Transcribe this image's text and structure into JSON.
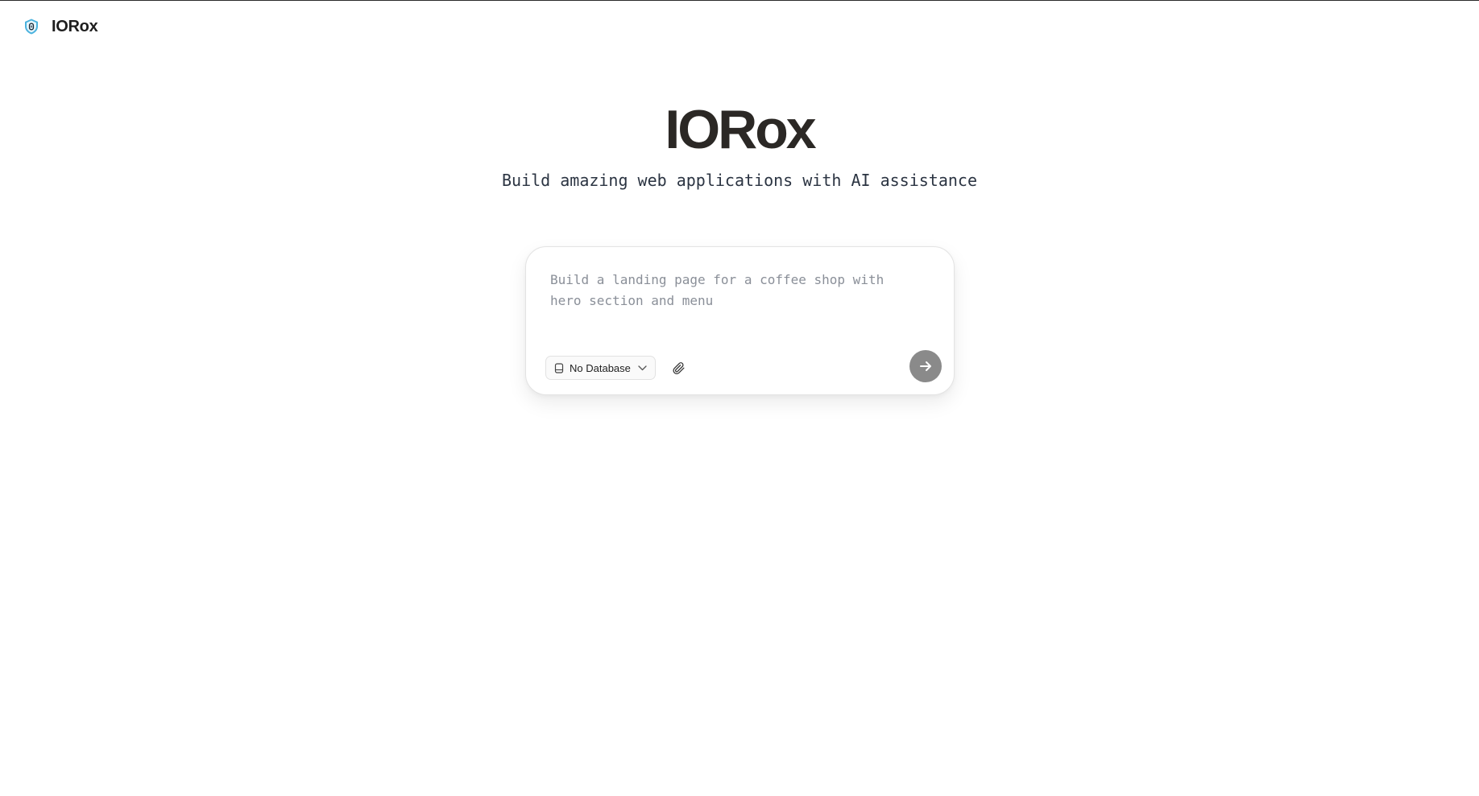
{
  "header": {
    "brand_name": "IORox",
    "logo_icon": "shield-logo-icon"
  },
  "hero": {
    "title": "IORox",
    "subtitle": "Build amazing web applications with AI assistance"
  },
  "prompt": {
    "placeholder": "Build a landing page for a coffee shop with hero section and menu",
    "value": "",
    "database_selector": {
      "selected_label": "No Database",
      "icon": "database-icon"
    },
    "attach_icon": "paperclip-icon",
    "send_icon": "arrow-right-icon"
  },
  "colors": {
    "title_text": "#2b2825",
    "send_button_bg": "#8a8a8a",
    "logo_accent": "#2aa5d8"
  }
}
